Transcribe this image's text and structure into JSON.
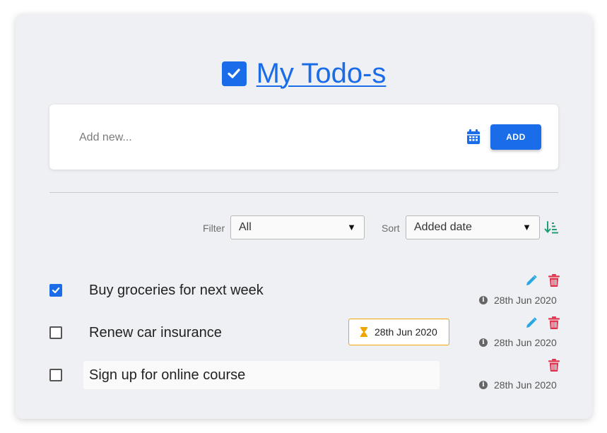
{
  "header": {
    "title": "My Todo-s",
    "logo_icon": "check-square-icon"
  },
  "add_new": {
    "placeholder": "Add new...",
    "calendar_icon": "calendar-icon",
    "add_label": "ADD"
  },
  "filter": {
    "label": "Filter",
    "selected": "All"
  },
  "sort": {
    "label": "Sort",
    "selected": "Added date",
    "direction_icon": "sort-ascending-icon"
  },
  "todos": [
    {
      "text": "Buy groceries for next week",
      "done": true,
      "due": null,
      "created": "28th Jun 2020"
    },
    {
      "text": "Renew car insurance",
      "done": false,
      "due": "28th Jun 2020",
      "created": "28th Jun 2020"
    },
    {
      "text": "Sign up for online course",
      "done": false,
      "due": null,
      "created": "28th Jun 2020"
    }
  ],
  "colors": {
    "accent": "#1a6ce8",
    "edit": "#2aa7e0",
    "delete": "#e0344e",
    "due_border": "#f0a500",
    "sort_icon": "#1e9e73"
  }
}
